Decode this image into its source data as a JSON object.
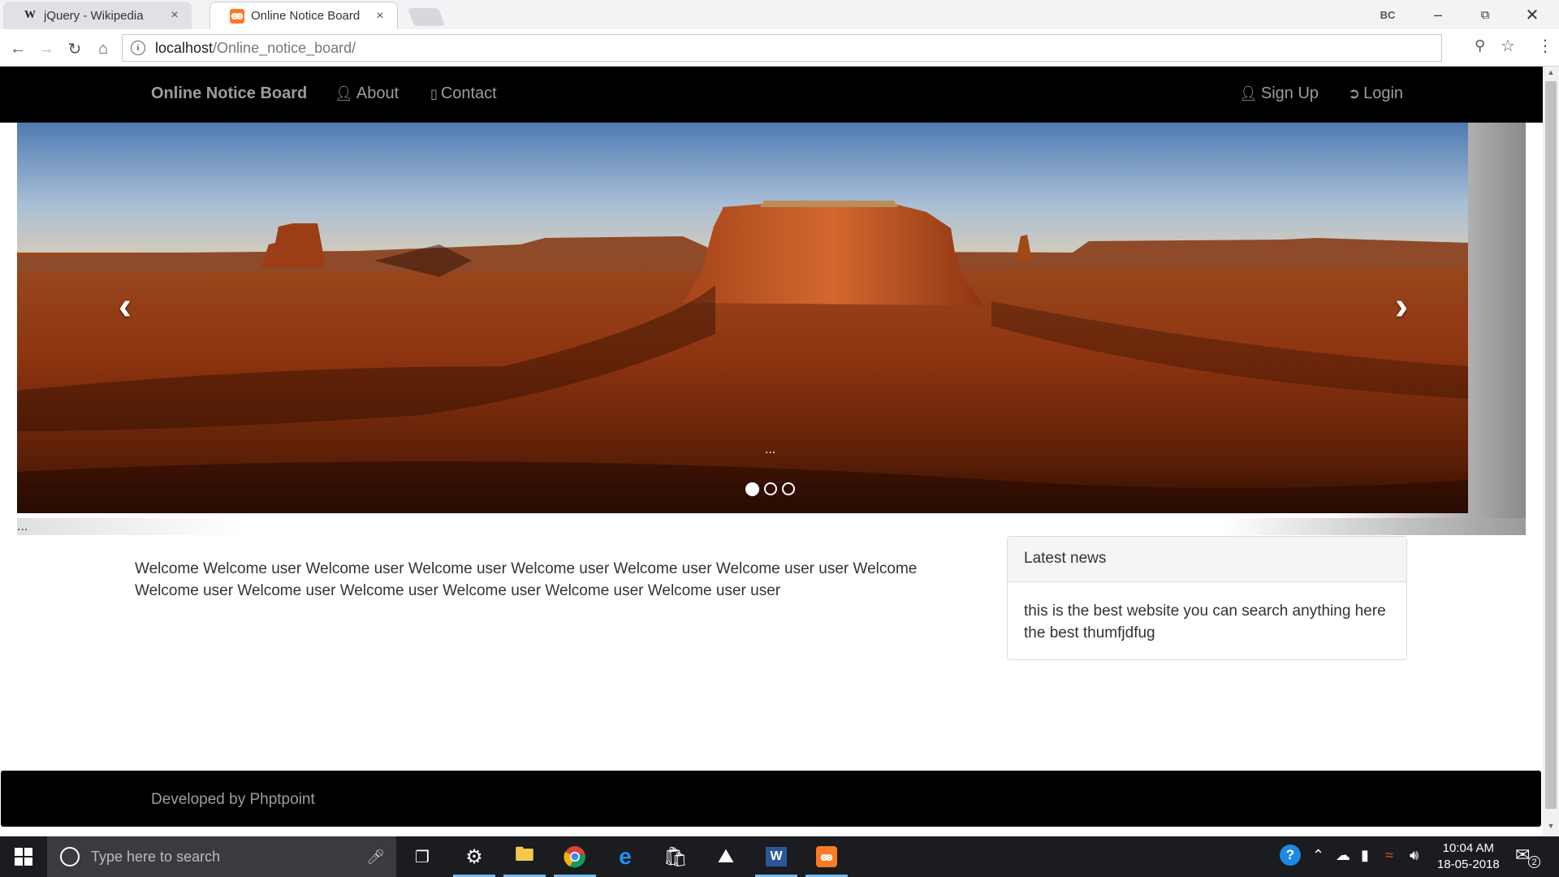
{
  "browser": {
    "tabs": [
      {
        "favicon": "W",
        "title": "jQuery - Wikipedia",
        "close": "×"
      },
      {
        "favicon": "ꙭ",
        "title": "Online Notice Board",
        "close": "×"
      }
    ],
    "profile_label": "BC",
    "address_host": "localhost",
    "address_path": "/Online_notice_board/"
  },
  "nav": {
    "brand": "Online Notice Board",
    "about": "About",
    "contact": "Contact",
    "signup": "Sign Up",
    "login": "Login"
  },
  "carousel": {
    "caption": "...",
    "below": "...",
    "indicator_count": 3,
    "active_index": 0
  },
  "main": {
    "welcome": "Welcome Welcome user Welcome user Welcome user Welcome user Welcome user Welcome user user Welcome Welcome user Welcome user Welcome user Welcome user Welcome user Welcome user user"
  },
  "news": {
    "heading": "Latest news",
    "body": "this is the best website you can search anything here the best thumfjdfug"
  },
  "footer": {
    "text": "Developed by Phptpoint"
  },
  "taskbar": {
    "search_placeholder": "Type here to search",
    "time": "10:04 AM",
    "date": "18-05-2018",
    "notification_count": "2"
  }
}
